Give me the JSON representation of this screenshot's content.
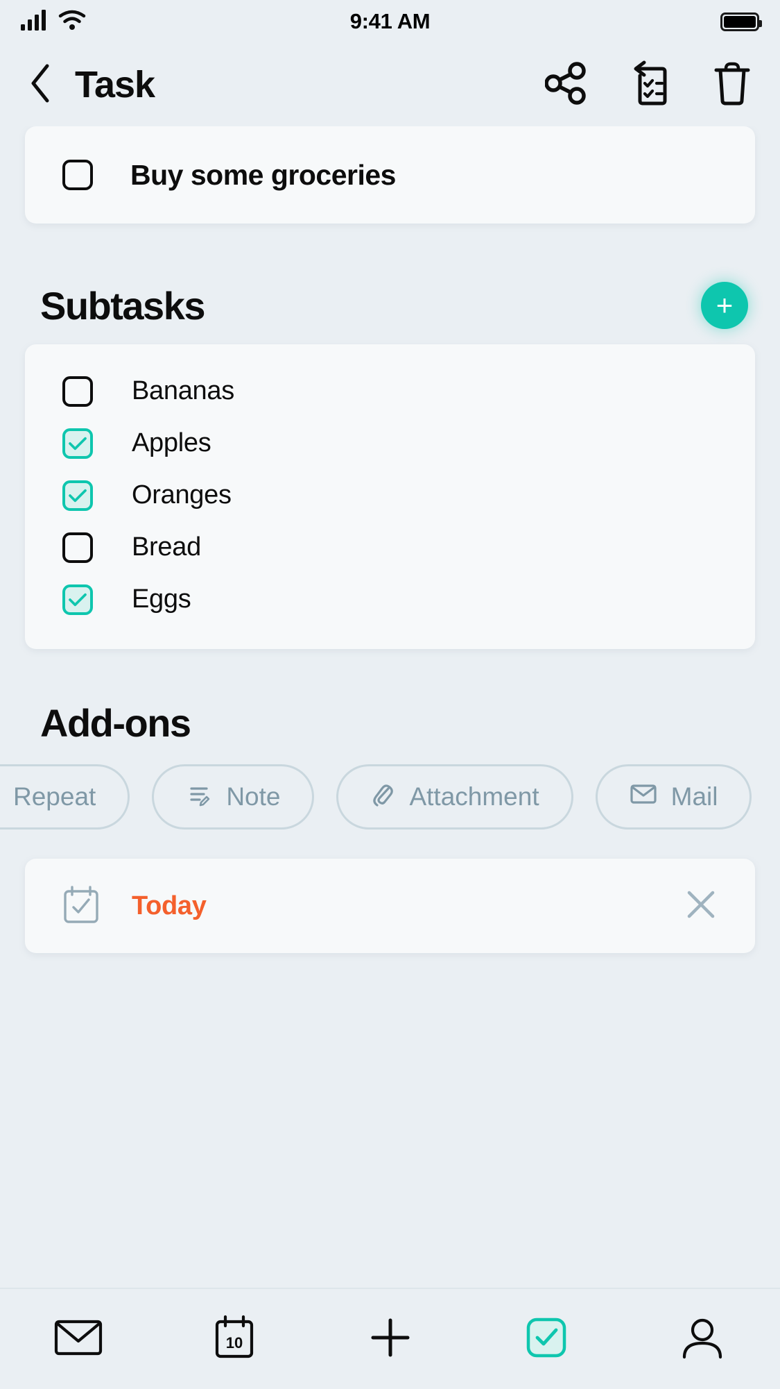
{
  "status_bar": {
    "time": "9:41 AM",
    "signal_icon": "cellular-signal-icon",
    "wifi_icon": "wifi-icon",
    "battery_icon": "battery-full-icon"
  },
  "header": {
    "back_icon": "chevron-left-icon",
    "title": "Task",
    "actions": [
      {
        "name": "share-icon",
        "label": "Share"
      },
      {
        "name": "move-to-list-icon",
        "label": "Move to list"
      },
      {
        "name": "trash-icon",
        "label": "Delete"
      }
    ]
  },
  "task": {
    "title": "Buy some groceries",
    "checked": false
  },
  "subtasks_section": {
    "title": "Subtasks",
    "add_label": "+",
    "items": [
      {
        "label": "Bananas",
        "checked": false
      },
      {
        "label": "Apples",
        "checked": true
      },
      {
        "label": "Oranges",
        "checked": true
      },
      {
        "label": "Bread",
        "checked": false
      },
      {
        "label": "Eggs",
        "checked": true
      }
    ]
  },
  "addons_section": {
    "title": "Add-ons",
    "chips": [
      {
        "label": "Repeat",
        "icon": "repeat-icon"
      },
      {
        "label": "Note",
        "icon": "note-icon"
      },
      {
        "label": "Attachment",
        "icon": "paperclip-icon"
      },
      {
        "label": "Mail",
        "icon": "envelope-icon"
      }
    ]
  },
  "due_date": {
    "label": "Today",
    "calendar_icon": "calendar-check-icon",
    "remove_icon": "close-icon",
    "color": "#f4602c"
  },
  "bottom_nav": [
    {
      "name": "nav-mail",
      "icon": "envelope-icon",
      "active": false
    },
    {
      "name": "nav-calendar",
      "icon": "calendar-icon",
      "active": false
    },
    {
      "name": "nav-add",
      "icon": "plus-icon",
      "active": false
    },
    {
      "name": "nav-tasks",
      "icon": "check-square-icon",
      "active": true
    },
    {
      "name": "nav-profile",
      "icon": "person-icon",
      "active": false
    }
  ],
  "colors": {
    "background": "#eaeff3",
    "card": "#f7f9fa",
    "accent": "#0ec6ae",
    "accent_soft": "#d9f2ef",
    "muted": "#7f98a6",
    "danger": "#f4602c",
    "text": "#0d0d0d"
  }
}
